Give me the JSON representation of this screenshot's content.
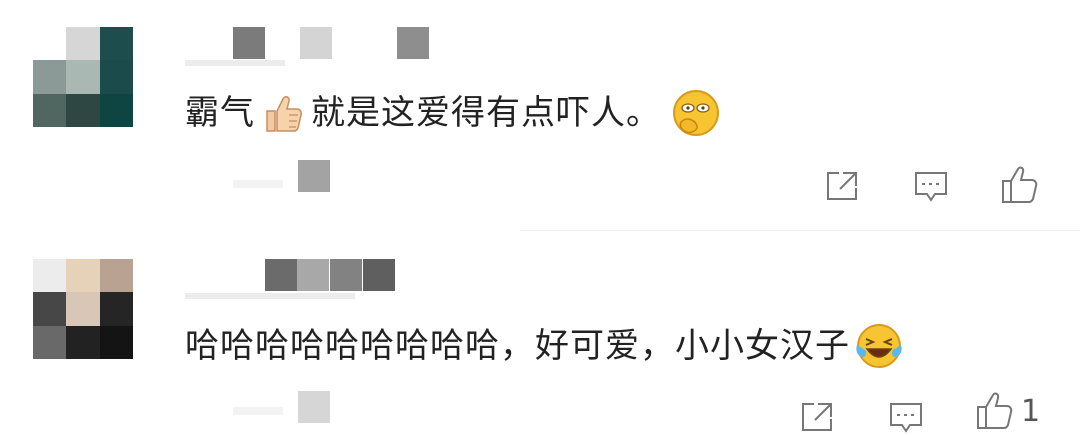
{
  "comments": [
    {
      "text_before_icon": "霸气",
      "inline_icon": "thumbs-up-emoji",
      "text_after_icon": "就是这爱得有点吓人。",
      "trailing_icon": "shy-face-emoji",
      "actions": {
        "share_icon": "share-icon",
        "reply_icon": "reply-icon",
        "like_icon": "like-icon",
        "like_count": ""
      }
    },
    {
      "text": "哈哈哈哈哈哈哈哈哈，好可爱，小小女汉子",
      "trailing_icon": "laughing-crying-emoji",
      "actions": {
        "share_icon": "share-icon",
        "reply_icon": "reply-icon",
        "like_icon": "like-icon",
        "like_count": "1"
      }
    }
  ],
  "colors": {
    "text": "#222222",
    "icon": "#777777",
    "divider": "#eeeeee",
    "emoji_yellow": "#f7c531"
  }
}
